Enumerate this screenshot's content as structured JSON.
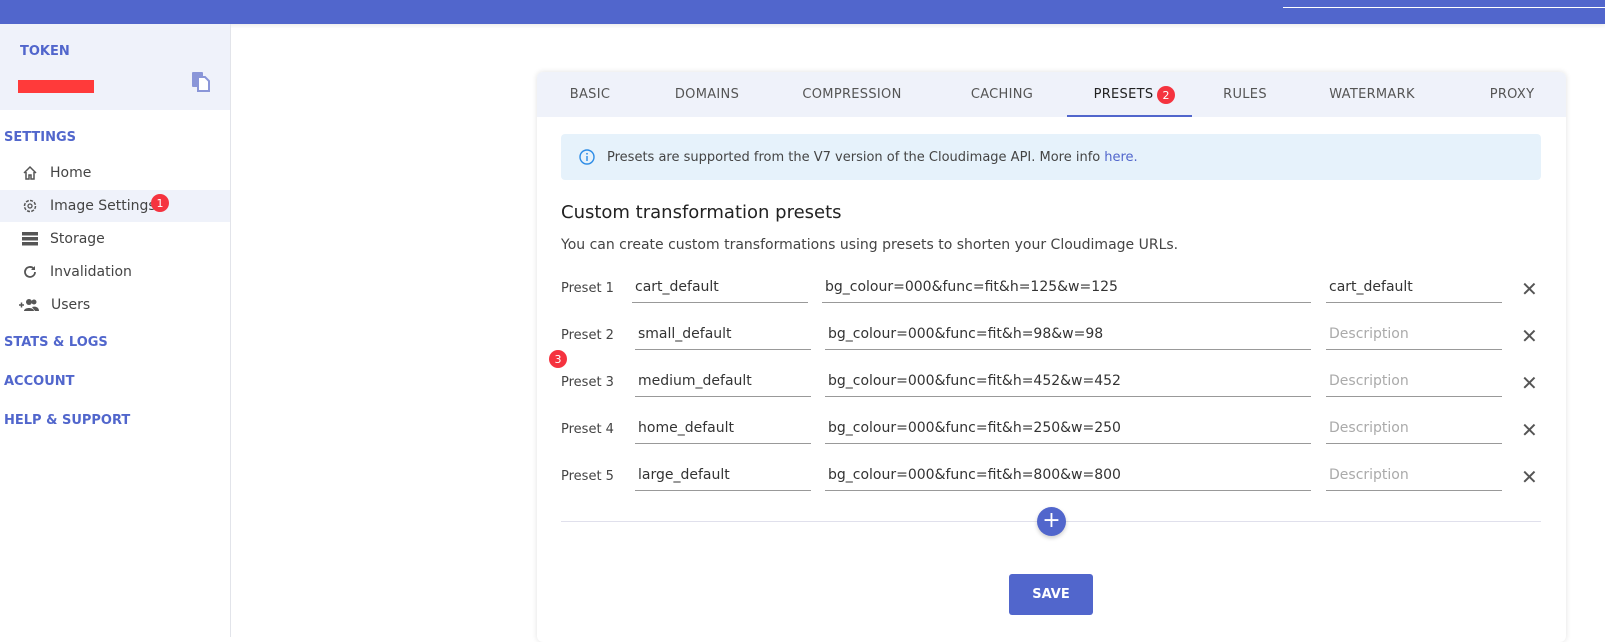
{
  "colors": {
    "accent": "#5166cc",
    "badge": "#f5333f",
    "info_bg": "#e6f2fb"
  },
  "sidebar": {
    "token_label": "TOKEN",
    "sections": [
      {
        "label": "SETTINGS"
      },
      {
        "label": "STATS & LOGS"
      },
      {
        "label": "ACCOUNT"
      },
      {
        "label": "HELP & SUPPORT"
      }
    ],
    "items": [
      {
        "label": "Home",
        "icon": "home-icon"
      },
      {
        "label": "Image Settings",
        "icon": "gear-icon",
        "badge": "1"
      },
      {
        "label": "Storage",
        "icon": "storage-icon"
      },
      {
        "label": "Invalidation",
        "icon": "refresh-icon"
      },
      {
        "label": "Users",
        "icon": "add-users-icon"
      }
    ]
  },
  "tabs": [
    {
      "label": "BASIC"
    },
    {
      "label": "DOMAINS"
    },
    {
      "label": "COMPRESSION"
    },
    {
      "label": "CACHING"
    },
    {
      "label": "PRESETS",
      "badge": "2",
      "active": true
    },
    {
      "label": "RULES"
    },
    {
      "label": "WATERMARK"
    },
    {
      "label": "PROXY"
    }
  ],
  "info": {
    "text": "Presets are supported from the V7 version of the Cloudimage API. More info",
    "link": "here."
  },
  "section_title": "Custom transformation presets",
  "section_desc": "You can create custom transformations using presets to shorten your Cloudimage URLs.",
  "row_badge": "3",
  "presets": [
    {
      "label": "Preset  1",
      "name": "cart_default",
      "value": "bg_colour=000&func=fit&h=125&w=125",
      "description": "cart_default"
    },
    {
      "label": "Preset  2",
      "name": "small_default",
      "value": "bg_colour=000&func=fit&h=98&w=98",
      "description": ""
    },
    {
      "label": "Preset  3",
      "name": "medium_default",
      "value": "bg_colour=000&func=fit&h=452&w=452",
      "description": ""
    },
    {
      "label": "Preset  4",
      "name": "home_default",
      "value": "bg_colour=000&func=fit&h=250&w=250",
      "description": ""
    },
    {
      "label": "Preset  5",
      "name": "large_default",
      "value": "bg_colour=000&func=fit&h=800&w=800",
      "description": ""
    }
  ],
  "description_placeholder": "Description",
  "add_label": "+",
  "remove_label": "✕",
  "save_label": "SAVE"
}
